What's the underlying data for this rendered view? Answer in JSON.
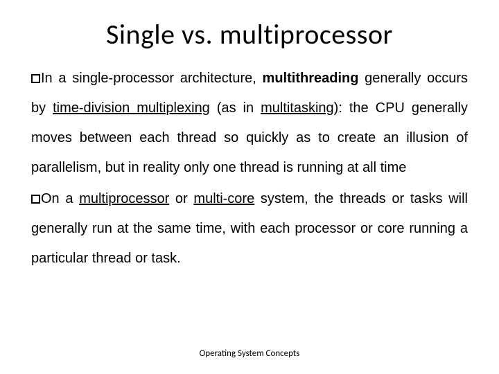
{
  "title": "Single vs. multiprocessor",
  "p1_lead": "In a single-processor architecture, ",
  "p1_bold": "multithreading",
  "p1_mid1": " generally occurs by ",
  "p1_link1": "time-division multiplexing",
  "p1_mid2": " (as in ",
  "p1_link2": "multitasking",
  "p1_tail": "): the CPU generally moves between each thread so quickly as to create an illusion of parallelism, but in reality only one thread is running at all time",
  "p2_lead": "On a ",
  "p2_link1": "multiprocessor",
  "p2_mid1": " or ",
  "p2_link2": "multi-core",
  "p2_tail": " system, the threads or tasks will generally run at the same time, with each processor or core running a particular thread or task.",
  "footer": "Operating System Concepts"
}
